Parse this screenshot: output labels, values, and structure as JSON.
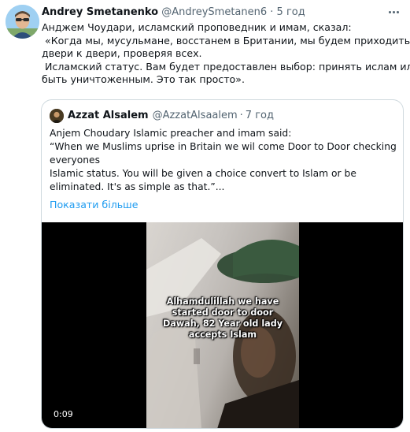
{
  "tweet": {
    "author_name": "Andrey Smetanenko",
    "author_handle": "@AndreySmetanen6",
    "separator": "·",
    "time": "5 год",
    "body_lines": [
      "Анджем Чоудари, исламский проповедник и имам, сказал:",
      "«Когда мы, мусульмане, восстанем в Британии, мы будем приходить от",
      "двери к двери, проверяя всех.",
      "Исламский статус.  Вам будет предоставлен выбор: принять ислам или",
      "быть уничтоженным.  Это так просто»."
    ]
  },
  "quoted": {
    "author_name": "Azzat Alsalem",
    "author_handle": "@AzzatAlsaalem",
    "separator": "·",
    "time": "7 год",
    "body_lines": [
      "Anjem Choudary Islamic preacher and imam said:",
      "“When we Muslims uprise in Britain we wil come Door to Door checking",
      "everyones",
      "Islamic status. You will be given a choice convert to Islam or be",
      "eliminated. It's as simple as that.”..."
    ],
    "show_more_label": "Показати більше",
    "video": {
      "caption": "Alhamdulillah we have started door to door Dawah, 82 Year old lady accepts Islam",
      "timestamp": "0:09"
    }
  },
  "colors": {
    "link": "#1d9bf0",
    "muted": "#536471",
    "border": "#cfd9de"
  },
  "icons": [
    "more-options-icon",
    "avatar-image",
    "quoted-avatar-image"
  ]
}
